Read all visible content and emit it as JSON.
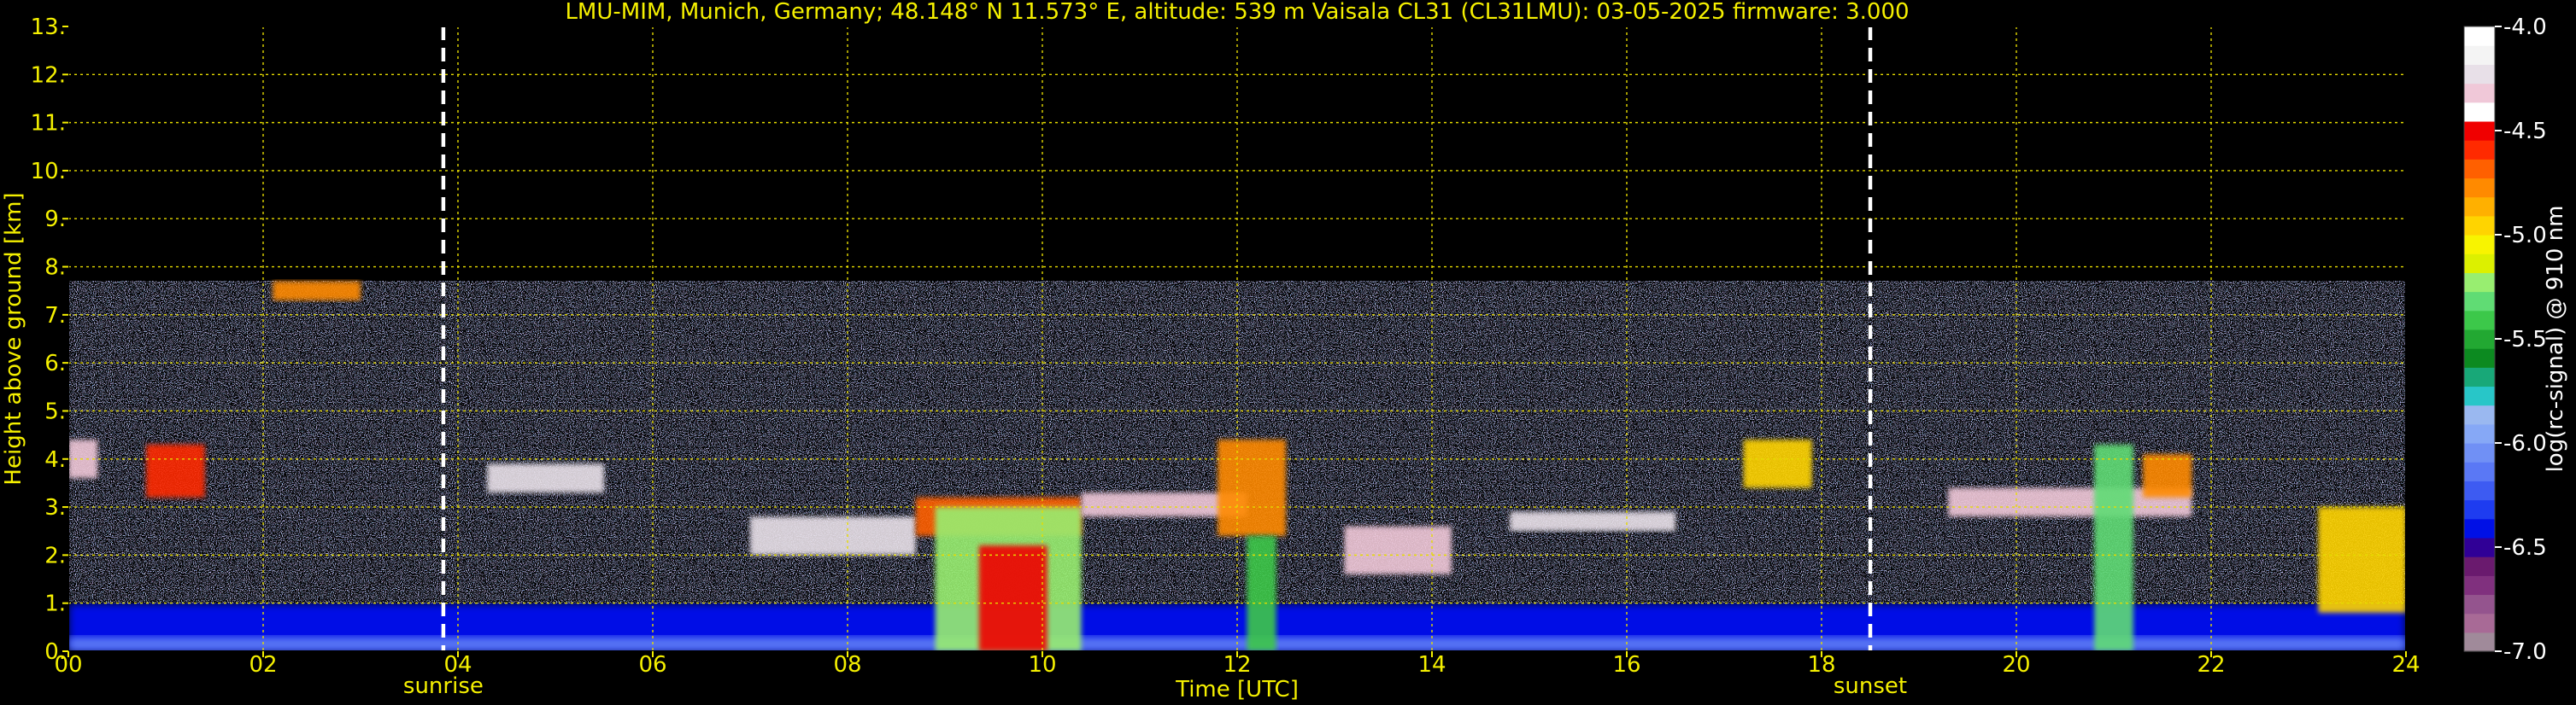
{
  "chart_data": {
    "type": "heatmap",
    "title": "LMU-MIM, Munich, Germany; 48.148° N 11.573° E, altitude: 539 m    Vaisala CL31 (CL31LMU): 03-05-2025    firmware: 3.000",
    "xlabel": "Time [UTC]",
    "ylabel": "Height above ground [km]",
    "xlim": [
      0,
      24
    ],
    "ylim": [
      0,
      13
    ],
    "x_ticks": [
      "00",
      "02",
      "04",
      "06",
      "08",
      "10",
      "12",
      "14",
      "16",
      "18",
      "20",
      "22",
      "24"
    ],
    "y_ticks": [
      "0.",
      "1.",
      "2.",
      "3.",
      "4.",
      "5.",
      "6.",
      "7.",
      "8.",
      "9.",
      "10.",
      "11.",
      "12.",
      "13."
    ],
    "grid": true,
    "markers": [
      {
        "label": "sunrise",
        "x": 3.85
      },
      {
        "label": "sunset",
        "x": 18.5
      }
    ],
    "colorbar": {
      "label": "log(rc-signal) @ 910 nm",
      "range": [
        -7.0,
        -4.0
      ],
      "tick_labels": [
        "-4.0",
        "-4.5",
        "-5.0",
        "-5.5",
        "-6.0",
        "-6.5",
        "-7.0"
      ],
      "colors": [
        "#a08a9a",
        "#a86a96",
        "#94548e",
        "#80307e",
        "#6a1a6e",
        "#300096",
        "#0010e6",
        "#1e3cf0",
        "#3d5bf2",
        "#5a78f5",
        "#7090f5",
        "#86a8f6",
        "#9ab8f0",
        "#28c6c8",
        "#18a878",
        "#0c8a20",
        "#22a832",
        "#3cc84a",
        "#60dc74",
        "#98ee70",
        "#dcf000",
        "#f8f400",
        "#ffd400",
        "#ffb000",
        "#ff8a00",
        "#ff6000",
        "#ff2a00",
        "#f00000",
        "#ffffff",
        "#f0c8d8",
        "#e8e0e8",
        "#f4f4f4",
        "#ffffff"
      ]
    },
    "features": [
      {
        "name": "boundary layer",
        "x": [
          0,
          24
        ],
        "height_km": [
          0,
          1.0
        ],
        "level": -6.4
      },
      {
        "name": "near-surface layer",
        "x": [
          0,
          24
        ],
        "height_km": [
          0,
          0.3
        ],
        "level": -6.1
      },
      {
        "name": "noise region",
        "x": [
          0,
          24
        ],
        "height_km": [
          1.0,
          7.7
        ],
        "level": -6.0
      },
      {
        "name": "cloud 1",
        "x": [
          0.0,
          0.3
        ],
        "height_km": [
          3.6,
          4.4
        ],
        "level": -4.3
      },
      {
        "name": "cloud 2",
        "x": [
          0.8,
          1.4
        ],
        "height_km": [
          3.2,
          4.3
        ],
        "level": -4.6
      },
      {
        "name": "cloud 3",
        "x": [
          2.1,
          3.0
        ],
        "height_km": [
          7.3,
          7.7
        ],
        "level": -4.8
      },
      {
        "name": "cloud 4",
        "x": [
          4.3,
          5.5
        ],
        "height_km": [
          3.3,
          3.9
        ],
        "level": -4.2
      },
      {
        "name": "cloud 5",
        "x": [
          7.0,
          8.7
        ],
        "height_km": [
          2.0,
          2.8
        ],
        "level": -4.2
      },
      {
        "name": "cloud 6",
        "x": [
          8.7,
          10.4
        ],
        "height_km": [
          2.4,
          3.2
        ],
        "level": -4.7
      },
      {
        "name": "precipitation 1",
        "x": [
          8.9,
          10.4
        ],
        "height_km": [
          0,
          3.0
        ],
        "level": -5.2
      },
      {
        "name": "precipitation core",
        "x": [
          9.35,
          10.05
        ],
        "height_km": [
          0,
          2.2
        ],
        "level": -4.5
      },
      {
        "name": "cloud 7",
        "x": [
          10.4,
          12.1
        ],
        "height_km": [
          2.8,
          3.3
        ],
        "level": -4.3
      },
      {
        "name": "cloud 8",
        "x": [
          11.8,
          12.5
        ],
        "height_km": [
          2.4,
          4.4
        ],
        "level": -4.8
      },
      {
        "name": "precipitation 2",
        "x": [
          12.1,
          12.4
        ],
        "height_km": [
          0,
          2.4
        ],
        "level": -5.4
      },
      {
        "name": "cloud 9",
        "x": [
          13.1,
          14.2
        ],
        "height_km": [
          1.6,
          2.6
        ],
        "level": -4.3
      },
      {
        "name": "cloud 10",
        "x": [
          14.8,
          16.5
        ],
        "height_km": [
          2.5,
          2.9
        ],
        "level": -4.2
      },
      {
        "name": "cloud 11",
        "x": [
          17.2,
          17.9
        ],
        "height_km": [
          3.4,
          4.4
        ],
        "level": -5.0
      },
      {
        "name": "cloud 12",
        "x": [
          19.3,
          21.8
        ],
        "height_km": [
          2.8,
          3.4
        ],
        "level": -4.3
      },
      {
        "name": "precipitation 3",
        "x": [
          20.8,
          21.2
        ],
        "height_km": [
          0,
          4.3
        ],
        "level": -5.3
      },
      {
        "name": "cloud 13",
        "x": [
          21.3,
          21.8
        ],
        "height_km": [
          3.2,
          4.1
        ],
        "level": -4.8
      },
      {
        "name": "cloud 14",
        "x": [
          23.1,
          24.0
        ],
        "height_km": [
          0.8,
          3.0
        ],
        "level": -5.0
      }
    ]
  }
}
